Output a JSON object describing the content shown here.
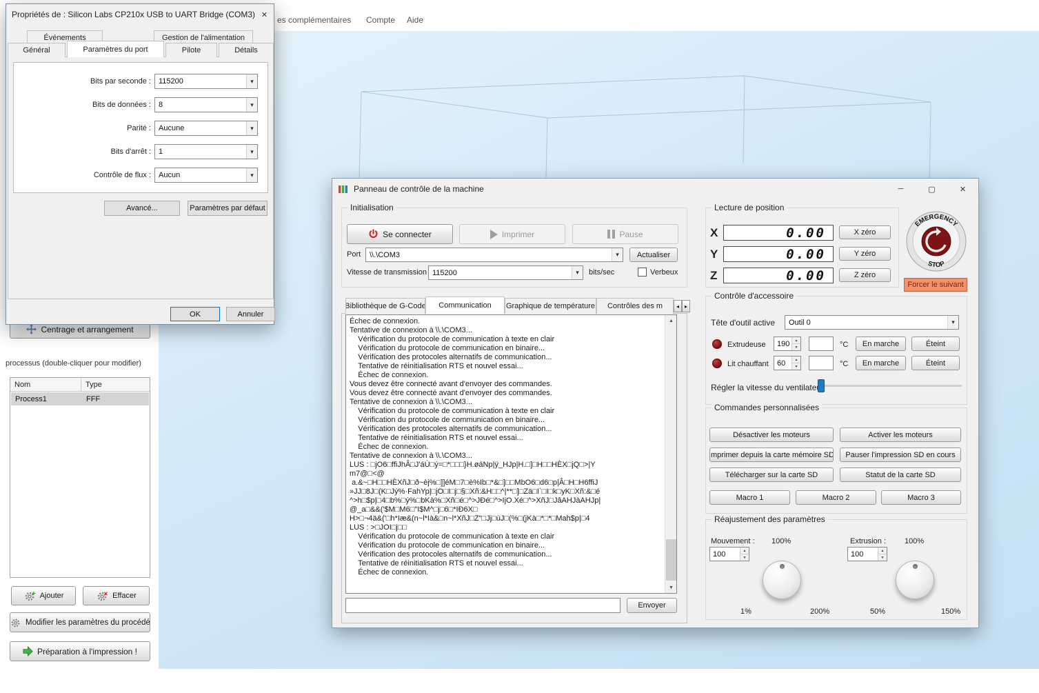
{
  "glyphs": {
    "close": "✕",
    "minimize": "─",
    "maximize": "▢",
    "combo_arrow": "▾",
    "spin_up": "▲",
    "spin_down": "▼",
    "scroll_up": "▲",
    "scroll_down": "▼",
    "tab_left": "◂",
    "tab_right": "▸"
  },
  "menubar": {
    "items": [
      "es complémentaires",
      "Compte",
      "Aide"
    ]
  },
  "sidebar": {
    "centering_button": "Centrage et arrangement",
    "process_label": "processus (double-cliquer pour modifier)",
    "table": {
      "col_nom": "Nom",
      "col_type": "Type",
      "row_nom": "Process1",
      "row_type": "FFF"
    },
    "add_button": "Ajouter",
    "delete_button": "Effacer",
    "edit_button": "Modifier les paramètres du procédé",
    "prepare_button": "Préparation à l'impression !"
  },
  "properties_dialog": {
    "title": "Propriétés de : Silicon Labs CP210x USB to UART Bridge (COM3)",
    "tab_events": "Événements",
    "tab_power": "Gestion de l'alimentation",
    "tab_general": "Général",
    "tab_port": "Paramètres du port",
    "tab_driver": "Pilote",
    "tab_details": "Détails",
    "fields": [
      {
        "label": "Bits par seconde :",
        "value": "115200"
      },
      {
        "label": "Bits de données :",
        "value": "8"
      },
      {
        "label": "Parité :",
        "value": "Aucune"
      },
      {
        "label": "Bits d'arrêt :",
        "value": "1"
      },
      {
        "label": "Contrôle de flux :",
        "value": "Aucun"
      }
    ],
    "advanced_button": "Avancé...",
    "defaults_button": "Paramètres par défaut",
    "ok_button": "OK",
    "cancel_button": "Annuler"
  },
  "machine_panel": {
    "title": "Panneau de contrôle de la machine",
    "init": {
      "title": "Initialisation",
      "connect": "Se connecter",
      "print": "Imprimer",
      "pause": "Pause",
      "port_label": "Port",
      "port_value": "\\\\.\\COM3",
      "refresh": "Actualiser",
      "baud_label": "Vitesse de transmission",
      "baud_value": "115200",
      "baud_unit": "bits/sec",
      "verbose": "Verbeux"
    },
    "tabs": [
      "Bibliothèque de G-Code",
      "Communication",
      "Graphique de température",
      "Contrôles des m"
    ],
    "log": [
      "Échec de connexion.",
      "Tentative de connexion à \\\\.\\COM3...",
      "    Vérification du protocole de communication à texte en clair",
      "    Vérification du protocole de communication en binaire...",
      "    Vérification des protocoles alternatifs de communication...",
      "    Tentative de réinitialisation RTS et nouvel essai...",
      "    Échec de connexion.",
      "Vous devez être connecté avant d'envoyer des commandes.",
      "Vous devez être connecté avant d'envoyer des commandes.",
      "Tentative de connexion à \\\\.\\COM3...",
      "    Vérification du protocole de communication à texte en clair",
      "    Vérification du protocole de communication en binaire...",
      "    Vérification des protocoles alternatifs de communication...",
      "    Tentative de réinitialisation RTS et nouvel essai...",
      "    Échec de connexion.",
      "Tentative de connexion à \\\\.\\COM3...",
      "LUS : □jO6□ffiJhÂ□J'áÙ□ý=□*□□□}H.øáNp|ÿ_HJp|H.□]□H□□HÈX□jQ□>|Y",
      "m7@□<@",
      " a.&~□H□□HÈXñJ□ð~èj%□]]éM□7□è%Ib□*&□]□□MbO6□d6□p|Â□H□H6ffiJ",
      "»JJ□8J□(K□Jý%·FahYp|□jO□I□j□§□Xñ:&H□□^|**□]□Zä□I`□I□k□yK□Xñ:&□é",
      "^>h□$p|□4□b%□ý%□bKà%□Xñ□é□^>JÐé□^>IjO.Xé□^>XñJ□JâAHJàAHJp|",
      "@_a□&&('$M□M6□\"I$M^□j□6□*IÐ6X□",
      "H>□¬4ä&('□h*Iæ&(n~l*Ià&□n~l*XñJ□Z\"□Jj□ùJ□(%□(jKà□*□*□Mah$p|□4",
      "LUS : >□JOI□j□□",
      "    Vérification du protocole de communication à texte en clair",
      "    Vérification du protocole de communication en binaire...",
      "    Vérification des protocoles alternatifs de communication...",
      "    Tentative de réinitialisation RTS et nouvel essai...",
      "    Échec de connexion."
    ],
    "send_button": "Envoyer",
    "position": {
      "title": "Lecture de position",
      "axes": [
        {
          "axis": "X",
          "value": "0.00",
          "zero": "X zéro"
        },
        {
          "axis": "Y",
          "value": "0.00",
          "zero": "Y zéro"
        },
        {
          "axis": "Z",
          "value": "0.00",
          "zero": "Z zéro"
        }
      ]
    },
    "emergency": {
      "line1": "EMERGENCY",
      "line2": "STOP"
    },
    "force_next": "Forcer le suivant",
    "accessory": {
      "title": "Contrôle d'accessoire",
      "toolhead_label": "Tête d'outil active",
      "toolhead_value": "Outil 0",
      "extruder_label": "Extrudeuse",
      "extruder_target": "190",
      "bed_label": "Lit chauffant",
      "bed_target": "60",
      "unit": "°C",
      "on_button": "En marche",
      "off_button": "Éteint",
      "fan_label": "Régler la vitesse du ventilateur"
    },
    "custom": {
      "title": "Commandes personnalisées",
      "buttons": [
        "Désactiver les moteurs",
        "Activer les moteurs",
        "Imprimer depuis la carte mémoire SD",
        "Pauser l'impression SD en cours",
        "Télécharger sur la carte SD",
        "Statut de la carte SD"
      ],
      "macros": [
        "Macro 1",
        "Macro 2",
        "Macro 3"
      ]
    },
    "adjust": {
      "title": "Réajustement des paramètres",
      "movement_label": "Mouvement :",
      "movement_pct": "100%",
      "movement_value": "100",
      "movement_min": "1%",
      "movement_max": "200%",
      "extrusion_label": "Extrusion :",
      "extrusion_pct": "100%",
      "extrusion_value": "100",
      "extrusion_min": "50%",
      "extrusion_max": "150%"
    }
  }
}
